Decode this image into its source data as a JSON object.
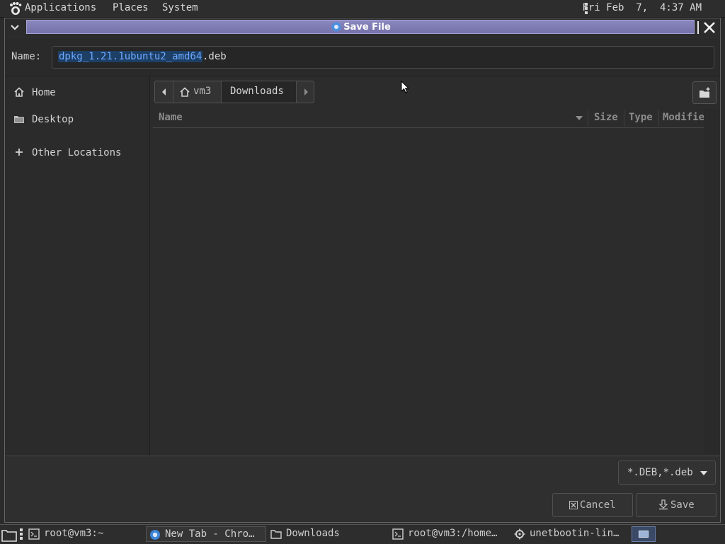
{
  "top_panel": {
    "menus": [
      "Applications",
      "Places",
      "System"
    ],
    "clock": "Fri Feb  7,  4:37 AM"
  },
  "dialog": {
    "title": "Save File",
    "name_label": "Name:",
    "filename_selected": "dpkg_1.21.1ubuntu2_amd64",
    "filename_ext": ".deb",
    "sidebar": [
      {
        "label": "Home",
        "icon": "home-icon"
      },
      {
        "label": "Desktop",
        "icon": "folder-icon"
      },
      {
        "label": "Other Locations",
        "icon": "plus-icon"
      }
    ],
    "path": [
      "vm3",
      "Downloads"
    ],
    "columns": [
      "Name",
      "Size",
      "Type",
      "Modifie"
    ],
    "filter": "*.DEB,*.deb",
    "cancel": "Cancel",
    "save": "Save"
  },
  "taskbar": {
    "items": [
      {
        "label": "root@vm3:~",
        "icon": "terminal-icon"
      },
      {
        "label": "New Tab - Chro…",
        "icon": "chrome-icon"
      },
      {
        "label": "Downloads",
        "icon": "folder-icon"
      },
      {
        "label": "root@vm3:/home…",
        "icon": "terminal-icon"
      },
      {
        "label": "unetbootin-lin…",
        "icon": "gear-icon"
      }
    ]
  },
  "colors": {
    "title_bar": "#7d7ab3",
    "selection": "#1d3f66",
    "selection_text": "#6ea8ff",
    "background": "#2b2b2b"
  }
}
